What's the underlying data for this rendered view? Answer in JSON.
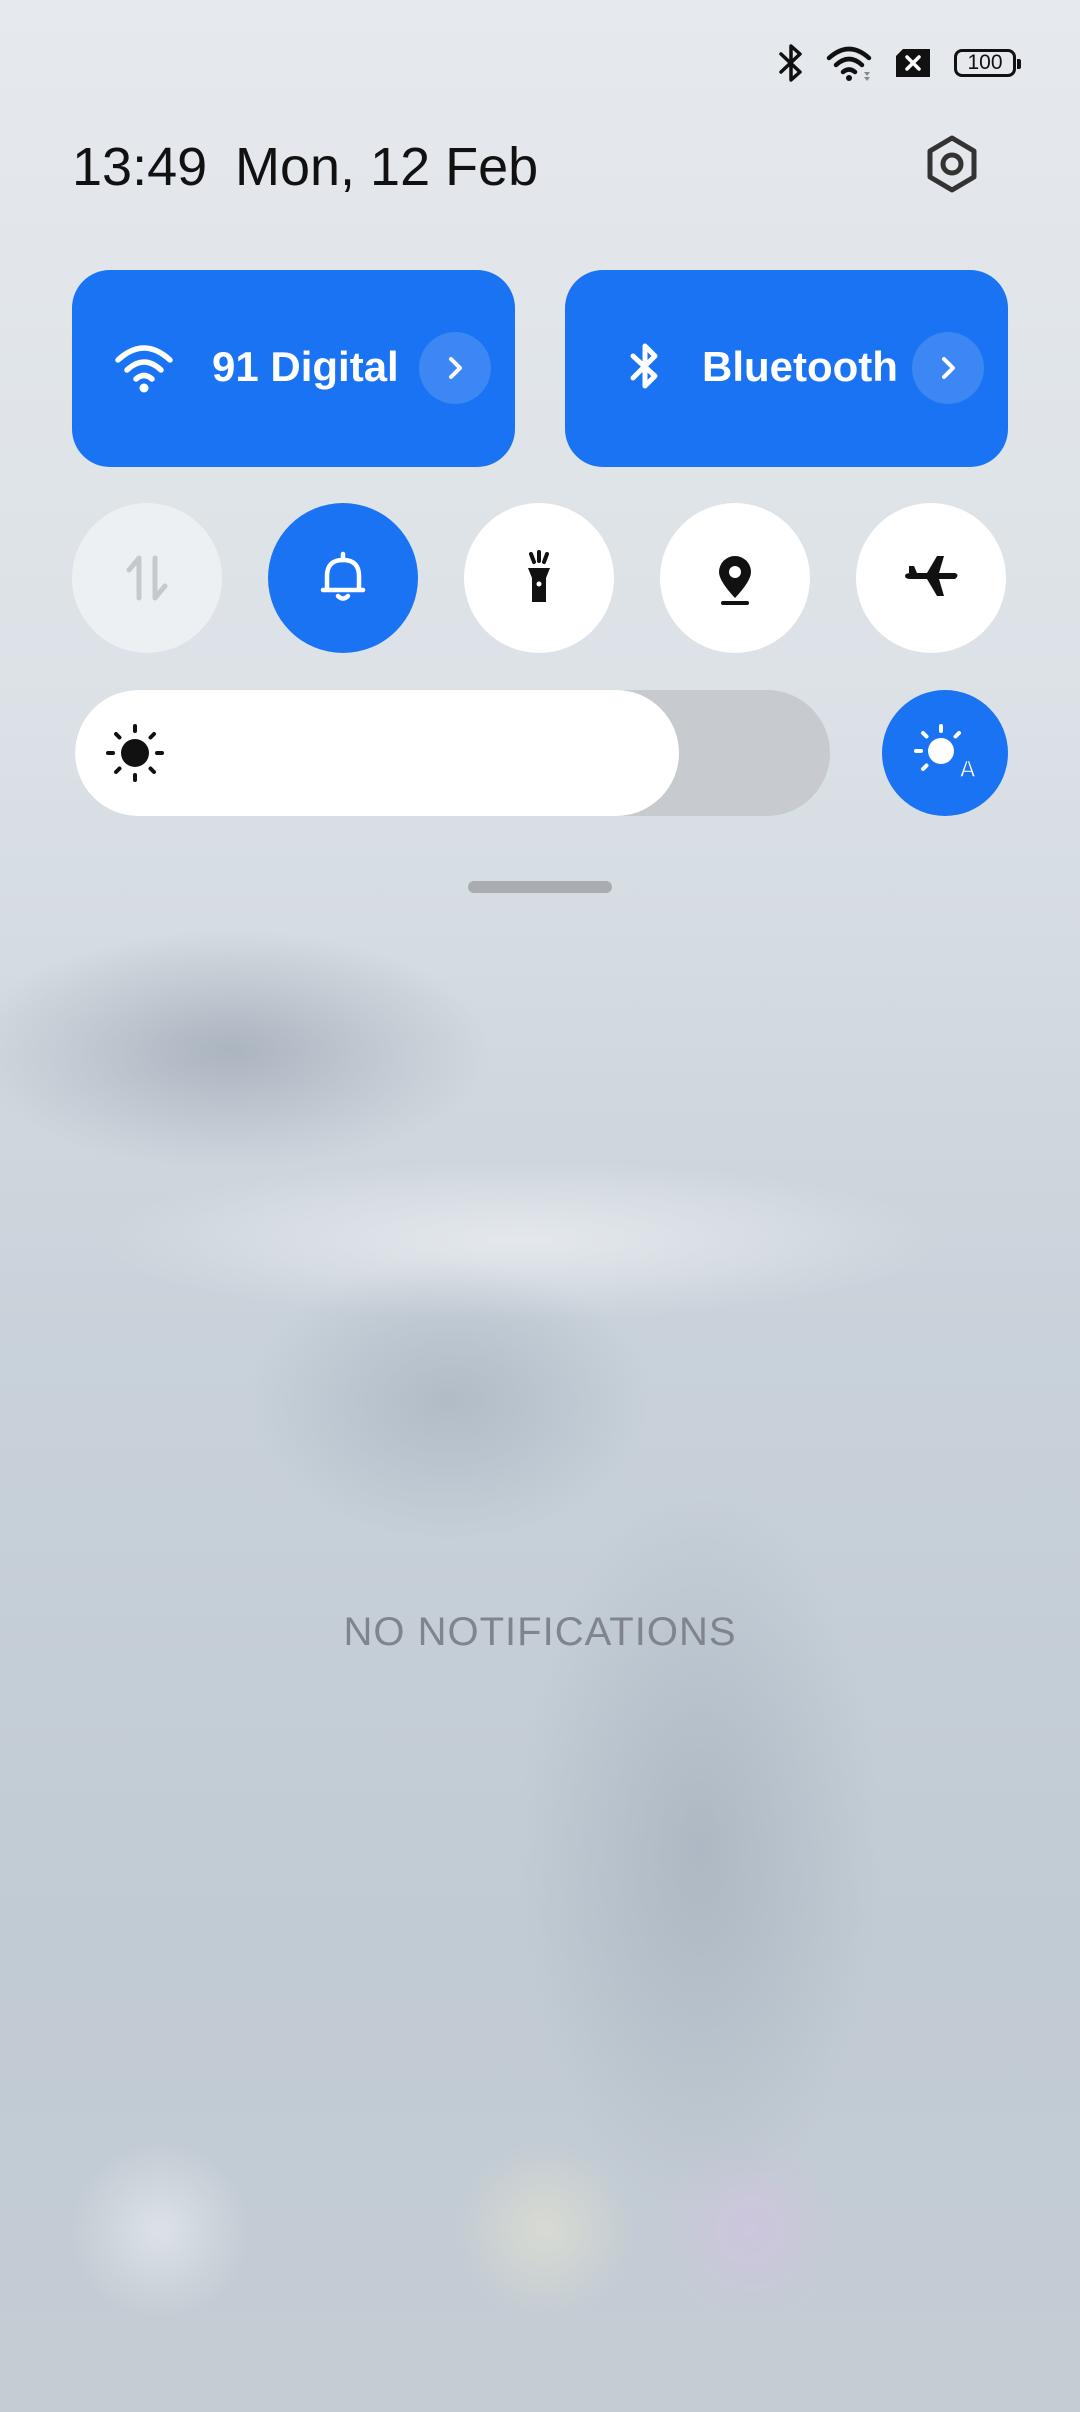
{
  "status_bar": {
    "icons": [
      "bluetooth-icon",
      "wifi-icon",
      "no-sim-icon",
      "battery-icon"
    ],
    "battery_level": "100"
  },
  "header": {
    "time": "13:49",
    "date": "Mon, 12 Feb",
    "settings_icon": "settings-icon"
  },
  "tiles": {
    "wifi": {
      "label": "91 Digital",
      "icon": "wifi-icon",
      "active": true
    },
    "bluetooth": {
      "label": "Bluetooth",
      "icon": "bluetooth-icon",
      "active": true
    }
  },
  "toggles": [
    {
      "name": "mobile-data",
      "icon": "mobile-data-icon",
      "state": "disabled"
    },
    {
      "name": "sound",
      "icon": "bell-icon",
      "state": "on"
    },
    {
      "name": "flashlight",
      "icon": "flashlight-icon",
      "state": "off"
    },
    {
      "name": "location",
      "icon": "location-icon",
      "state": "off"
    },
    {
      "name": "airplane-mode",
      "icon": "airplane-icon",
      "state": "off"
    }
  ],
  "brightness": {
    "level_percent": 80,
    "auto_brightness": true
  },
  "notifications": {
    "empty_text": "NO NOTIFICATIONS"
  },
  "colors": {
    "accent": "#1a73f2",
    "tile_text": "#ffffff",
    "track": "#c7cbcf"
  }
}
